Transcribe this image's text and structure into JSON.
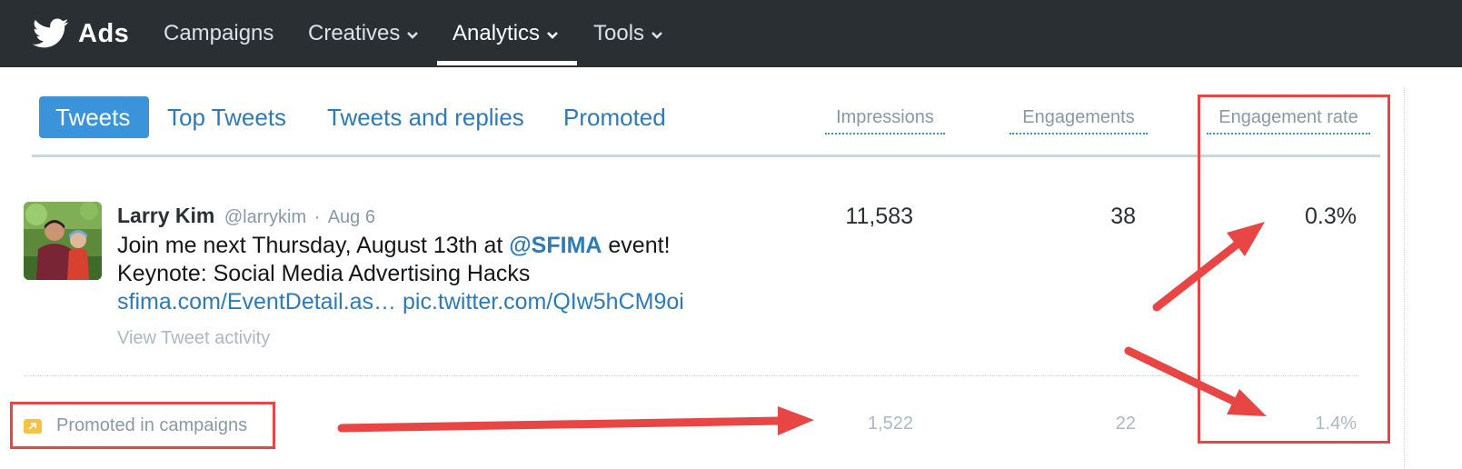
{
  "topnav": {
    "brand": "Ads",
    "items": [
      {
        "label": "Campaigns",
        "dropdown": false,
        "active": false
      },
      {
        "label": "Creatives",
        "dropdown": true,
        "active": false
      },
      {
        "label": "Analytics",
        "dropdown": true,
        "active": true
      },
      {
        "label": "Tools",
        "dropdown": true,
        "active": false
      }
    ]
  },
  "tabs": [
    {
      "label": "Tweets",
      "selected": true
    },
    {
      "label": "Top Tweets",
      "selected": false
    },
    {
      "label": "Tweets and replies",
      "selected": false
    },
    {
      "label": "Promoted",
      "selected": false
    }
  ],
  "columns": {
    "impressions": "Impressions",
    "engagements": "Engagements",
    "engagement_rate": "Engagement rate"
  },
  "tweet": {
    "author_name": "Larry Kim",
    "handle": "@larrykim",
    "separator": "·",
    "date": "Aug 6",
    "line1_text": "Join me next Thursday, August 13th at",
    "mention": "@SFIMA",
    "line1_tail": "event!",
    "line2_text": "Keynote: Social Media Advertising Hacks",
    "link1": "sfima.com/EventDetail.as…",
    "link2": "pic.twitter.com/QIw5hCM9oi",
    "view_activity": "View Tweet activity",
    "impressions": "11,583",
    "engagements": "38",
    "engagement_rate": "0.3%"
  },
  "promoted": {
    "label": "Promoted in campaigns",
    "impressions": "1,522",
    "engagements": "22",
    "engagement_rate": "1.4%"
  },
  "colors": {
    "nav_bg": "#292f33",
    "accent": "#3b94d9",
    "link": "#2b7bb9",
    "annotation": "#e84545",
    "promo_icon": "#f6c242"
  }
}
